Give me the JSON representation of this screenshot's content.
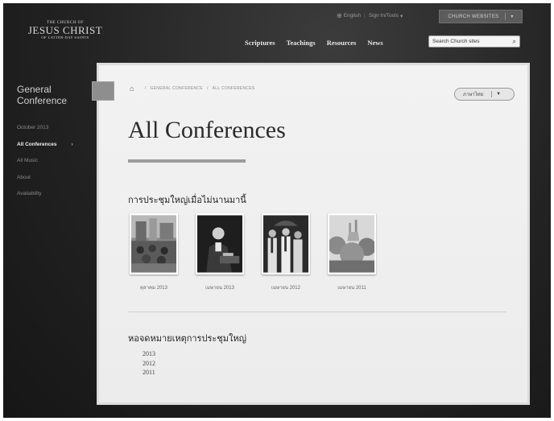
{
  "logo": {
    "line1": "THE CHURCH OF",
    "line2": "JESUS CHRIST",
    "line3": "OF LATTER-DAY SAINTS"
  },
  "utility": {
    "language": "English",
    "sign_in": "Sign In/Tools",
    "church_websites": "CHURCH WEBSITES"
  },
  "nav": {
    "items": [
      "Scriptures",
      "Teachings",
      "Resources",
      "News"
    ]
  },
  "search": {
    "placeholder": "Search Church sites"
  },
  "sidebar": {
    "title": "General Conference",
    "items": [
      {
        "label": "October 2013"
      },
      {
        "label": "All Conferences"
      },
      {
        "label": "All Music"
      },
      {
        "label": "About"
      },
      {
        "label": "Availability"
      }
    ]
  },
  "breadcrumb": {
    "items": [
      "GENERAL CONFERENCE",
      "ALL CONFERENCES"
    ]
  },
  "language_select": {
    "value": "ภาษาไทย"
  },
  "page_title": "All Conferences",
  "recent": {
    "heading": "การประชุมใหญ่เมื่อไม่นานมานี้",
    "items": [
      {
        "caption": "ตุลาคม 2013"
      },
      {
        "caption": "เมษายน 2013"
      },
      {
        "caption": "เมษายน 2012"
      },
      {
        "caption": "เมษายน 2011"
      }
    ]
  },
  "archive": {
    "heading": "หอจดหมายเหตุการประชุมใหญ่",
    "years": [
      "2013",
      "2012",
      "2011"
    ]
  }
}
